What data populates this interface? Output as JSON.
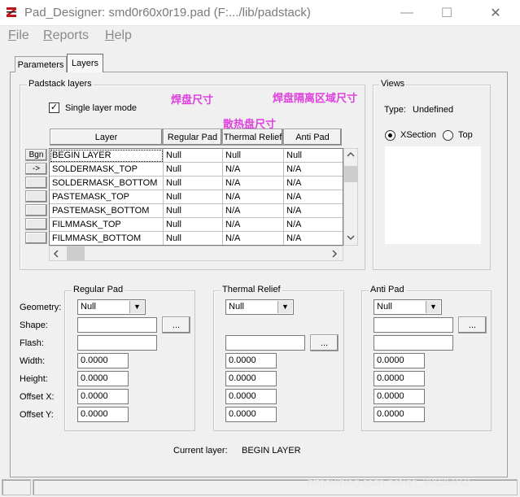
{
  "window": {
    "title": "Pad_Designer: smd0r60x0r19.pad (F:.../lib/padstack)",
    "minimize_glyph": "—",
    "maximize_glyph": "☐",
    "close_glyph": "✕"
  },
  "menu": [
    {
      "mnemonic": "F",
      "rest": "ile"
    },
    {
      "mnemonic": "R",
      "rest": "eports"
    },
    {
      "mnemonic": "H",
      "rest": "elp"
    }
  ],
  "tabs": {
    "parameters": "Parameters",
    "layers": "Layers",
    "active": "Layers"
  },
  "padstack": {
    "group_label": "Padstack layers",
    "single_layer_mode": {
      "label": "Single layer mode",
      "checked": true,
      "mark": "✓"
    },
    "annotations": {
      "regular": "焊盘尺寸",
      "anti": "焊盘隔离区域尺寸",
      "thermal": "散热盘尺寸"
    },
    "bgn_label": "Bgn",
    "row_arrow": "->",
    "columns": [
      "Layer",
      "Regular Pad",
      "Thermal Relief",
      "Anti Pad"
    ],
    "rows": [
      [
        "BEGIN LAYER",
        "Null",
        "Null",
        "Null"
      ],
      [
        "SOLDERMASK_TOP",
        "Null",
        "N/A",
        "N/A"
      ],
      [
        "SOLDERMASK_BOTTOM",
        "Null",
        "N/A",
        "N/A"
      ],
      [
        "PASTEMASK_TOP",
        "Null",
        "N/A",
        "N/A"
      ],
      [
        "PASTEMASK_BOTTOM",
        "Null",
        "N/A",
        "N/A"
      ],
      [
        "FILMMASK_TOP",
        "Null",
        "N/A",
        "N/A"
      ],
      [
        "FILMMASK_BOTTOM",
        "Null",
        "N/A",
        "N/A"
      ]
    ],
    "selected_row": 0
  },
  "views": {
    "group_label": "Views",
    "type_label": "Type:",
    "type_value": "Undefined",
    "options": [
      {
        "label": "XSection",
        "selected": true
      },
      {
        "label": "Top",
        "selected": false
      }
    ]
  },
  "fields": {
    "geometry": "Geometry:",
    "shape": "Shape:",
    "flash": "Flash:",
    "width": "Width:",
    "height": "Height:",
    "offset_x": "Offset X:",
    "offset_y": "Offset Y:"
  },
  "regular_pad": {
    "label": "Regular Pad",
    "geometry": "Null",
    "shape": "",
    "flash": "",
    "width": "0.0000",
    "height": "0.0000",
    "offset_x": "0.0000",
    "offset_y": "0.0000",
    "browse": "..."
  },
  "thermal_relief": {
    "label": "Thermal Relief",
    "geometry": "Null",
    "flash": "",
    "width": "0.0000",
    "height": "0.0000",
    "offset_x": "0.0000",
    "offset_y": "0.0000",
    "browse": "..."
  },
  "anti_pad": {
    "label": "Anti Pad",
    "geometry": "Null",
    "shape": "",
    "flash": "",
    "width": "0.0000",
    "height": "0.0000",
    "offset_x": "0.0000",
    "offset_y": "0.0000",
    "browse": "..."
  },
  "current_layer": {
    "label": "Current layer:",
    "value": "BEGIN LAYER"
  },
  "watermark": "https://blog.csdn.net/qq_39035910"
}
